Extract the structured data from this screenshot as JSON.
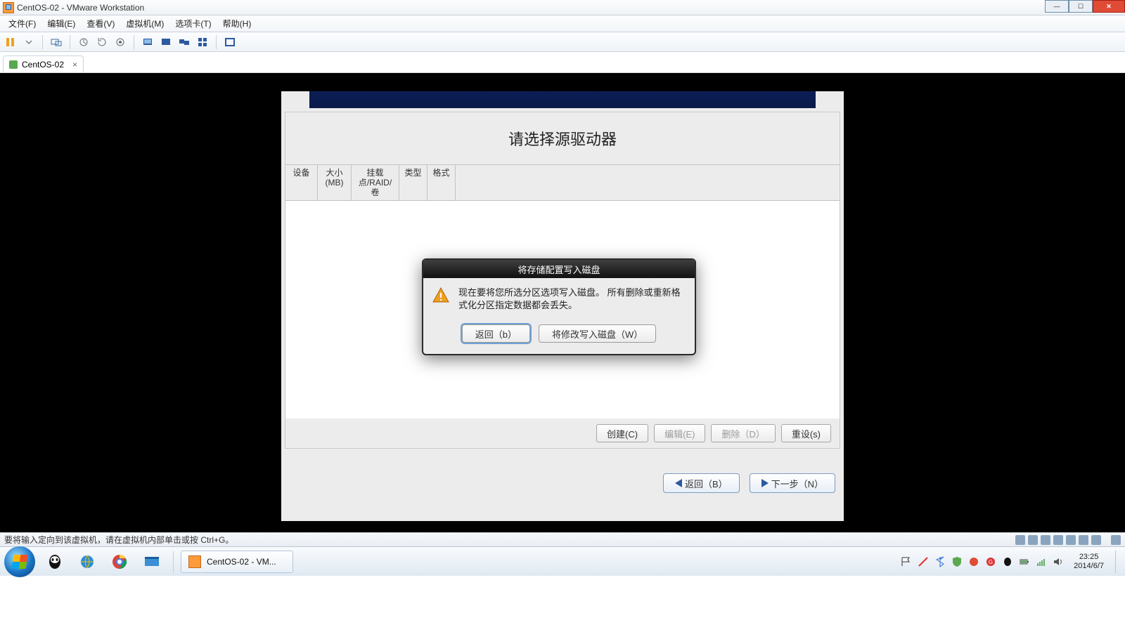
{
  "window": {
    "title": "CentOS-02 - VMware Workstation"
  },
  "menu": {
    "file": "文件(F)",
    "edit": "编辑(E)",
    "view": "查看(V)",
    "vm": "虚拟机(M)",
    "tabs": "选项卡(T)",
    "help": "帮助(H)"
  },
  "tab": {
    "label": "CentOS-02"
  },
  "installer": {
    "title": "请选择源驱动器",
    "columns": {
      "device": "设备",
      "size": "大小 (MB)",
      "mount": "挂载点/RAID/卷",
      "type": "类型",
      "format": "格式"
    },
    "buttons": {
      "create": "创建(C)",
      "edit": "编辑(E)",
      "delete": "删除（D）",
      "reset": "重设(s)"
    },
    "nav": {
      "back": "返回（B）",
      "next": "下一步（N）"
    }
  },
  "dialog": {
    "title": "将存储配置写入磁盘",
    "body": "现在要将您所选分区选项写入磁盘。 所有删除或重新格式化分区指定数据都会丢失。",
    "back": "返回（b）",
    "write": "将修改写入磁盘（W）"
  },
  "status": {
    "text": "要将输入定向到该虚拟机，请在虚拟机内部单击或按 Ctrl+G。"
  },
  "taskbar": {
    "task": "CentOS-02 - VM..."
  },
  "clock": {
    "time": "23:25",
    "date": "2014/6/7"
  }
}
